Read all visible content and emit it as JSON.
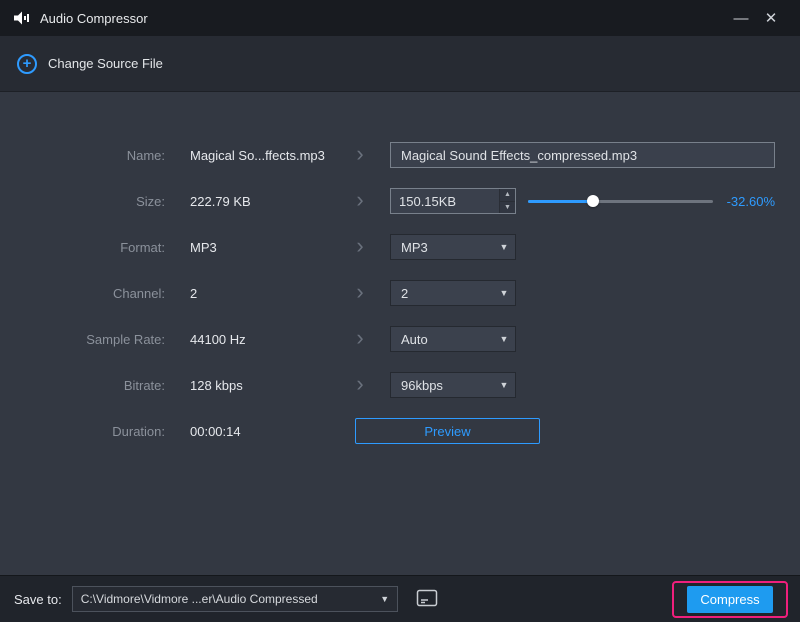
{
  "window": {
    "title": "Audio Compressor",
    "minimize_glyph": "—",
    "close_glyph": "✕"
  },
  "header": {
    "change_source_label": "Change Source File",
    "plus_glyph": "+"
  },
  "form": {
    "chevron_glyph": "›",
    "rows": [
      {
        "label": "Name:",
        "value": "Magical So...ffects.mp3",
        "input": "Magical Sound Effects_compressed.mp3"
      },
      {
        "label": "Size:",
        "value": "222.79 KB",
        "input": "150.15KB",
        "slider_percent": 35,
        "reduction": "-32.60%"
      },
      {
        "label": "Format:",
        "value": "MP3",
        "select": "MP3"
      },
      {
        "label": "Channel:",
        "value": "2",
        "select": "2"
      },
      {
        "label": "Sample Rate:",
        "value": "44100 Hz",
        "select": "Auto"
      },
      {
        "label": "Bitrate:",
        "value": "128 kbps",
        "select": "96kbps"
      },
      {
        "label": "Duration:",
        "value": "00:00:14",
        "button": "Preview"
      }
    ],
    "dropdown_arrow_glyph": "▼",
    "stepper_up_glyph": "▲",
    "stepper_down_glyph": "▼"
  },
  "footer": {
    "save_to_label": "Save to:",
    "path": "C:\\Vidmore\\Vidmore ...er\\Audio Compressed",
    "path_arrow_glyph": "▼",
    "compress_label": "Compress"
  },
  "colors": {
    "accent_blue": "#1e9bf0",
    "link_blue": "#2e9bff",
    "annotation_pink": "#ee1f7c",
    "background": "#333842",
    "titlebar": "#181b20"
  }
}
